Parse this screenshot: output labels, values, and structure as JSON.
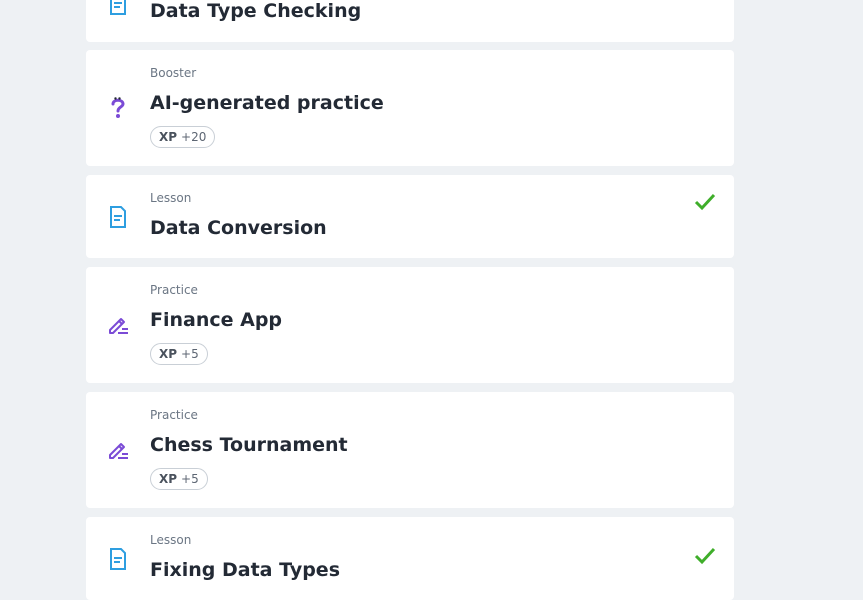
{
  "colors": {
    "background": "#eef1f4",
    "card": "#ffffff",
    "lesson_icon": "#2e9ee0",
    "practice_icon": "#7b4bd6",
    "check": "#3fae2a"
  },
  "items": [
    {
      "icon": "document-icon",
      "kind": "",
      "title": "Data Type Checking",
      "completed": false
    },
    {
      "icon": "question-mark-icon",
      "kind": "Booster",
      "title": "AI-generated practice",
      "xp_label": "XP",
      "xp_value": "+20",
      "completed": false
    },
    {
      "icon": "document-icon",
      "kind": "Lesson",
      "title": "Data Conversion",
      "completed": true
    },
    {
      "icon": "pencil-icon",
      "kind": "Practice",
      "title": "Finance App",
      "xp_label": "XP",
      "xp_value": "+5",
      "completed": false
    },
    {
      "icon": "pencil-icon",
      "kind": "Practice",
      "title": "Chess Tournament",
      "xp_label": "XP",
      "xp_value": "+5",
      "completed": false
    },
    {
      "icon": "document-icon",
      "kind": "Lesson",
      "title": "Fixing Data Types",
      "completed": true
    }
  ]
}
